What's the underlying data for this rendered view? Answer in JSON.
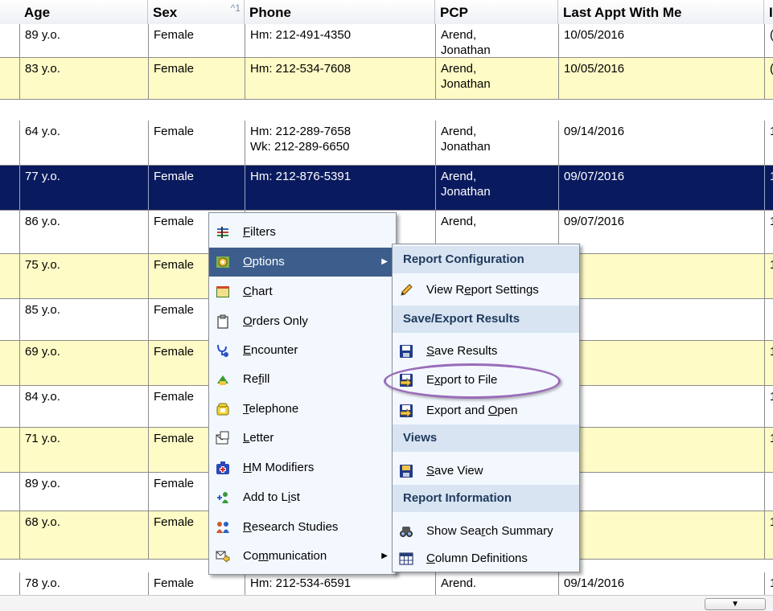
{
  "headers": {
    "age": "Age",
    "sex": "Sex",
    "sex_sort": "^1",
    "phone": "Phone",
    "pcp": "PCP",
    "last_appt": "Last Appt With Me",
    "extra": "I"
  },
  "rows": [
    {
      "age": "89 y.o.",
      "sex": "Female",
      "phone1": "Hm: 212-491-4350",
      "phone2": "",
      "pcp1": "Arend,",
      "pcp2": "Jonathan",
      "last": "10/05/2016",
      "extra": "("
    },
    {
      "age": "83 y.o.",
      "sex": "Female",
      "phone1": "Hm: 212-534-7608",
      "phone2": "",
      "pcp1": "Arend,",
      "pcp2": "Jonathan",
      "last": "10/05/2016",
      "extra": "("
    },
    {
      "age": "64 y.o.",
      "sex": "Female",
      "phone1": "Hm: 212-289-7658",
      "phone2": "Wk: 212-289-6650",
      "pcp1": "Arend,",
      "pcp2": "Jonathan",
      "last": "09/14/2016",
      "extra": "1"
    },
    {
      "age": "77 y.o.",
      "sex": "Female",
      "phone1": "Hm: 212-876-5391",
      "phone2": "",
      "pcp1": "Arend,",
      "pcp2": "Jonathan",
      "last": "09/07/2016",
      "extra": "1"
    },
    {
      "age": "86 y.o.",
      "sex": "Female",
      "phone1": "",
      "phone2": "",
      "pcp1": "Arend,",
      "pcp2": "",
      "last": "09/07/2016",
      "extra": "1"
    },
    {
      "age": "75 y.o.",
      "sex": "Female",
      "phone1": "",
      "phone2": "",
      "pcp1": "",
      "pcp2": "",
      "last": "",
      "extra": "1"
    },
    {
      "age": "85 y.o.",
      "sex": "Female",
      "phone1": "",
      "phone2": "",
      "pcp1": "",
      "pcp2": "",
      "last": "",
      "extra": ""
    },
    {
      "age": "69 y.o.",
      "sex": "Female",
      "phone1": "",
      "phone2": "",
      "pcp1": "",
      "pcp2": "",
      "last": "",
      "extra": "1"
    },
    {
      "age": "84 y.o.",
      "sex": "Female",
      "phone1": "",
      "phone2": "",
      "pcp1": "",
      "pcp2": "",
      "last": "",
      "extra": "1"
    },
    {
      "age": "71 y.o.",
      "sex": "Female",
      "phone1": "",
      "phone2": "",
      "pcp1": "",
      "pcp2": "",
      "last": "",
      "extra": "1"
    },
    {
      "age": "89 y.o.",
      "sex": "Female",
      "phone1": "",
      "phone2": "",
      "pcp1": "",
      "pcp2": "",
      "last": "",
      "extra": ""
    },
    {
      "age": "68 y.o.",
      "sex": "Female",
      "phone1": "",
      "phone2": "",
      "pcp1": "",
      "pcp2": "",
      "last": "",
      "extra": "1"
    },
    {
      "age": "78 y.o.",
      "sex": "Female",
      "phone1": "Hm: 212-534-6591",
      "phone2": "",
      "pcp1": "Arend.",
      "pcp2": "",
      "last": "09/14/2016",
      "extra": "1"
    }
  ],
  "menu1": [
    {
      "icon": "filters-icon",
      "pre": "",
      "u": "F",
      "post": "ilters"
    },
    {
      "icon": "options-icon",
      "pre": "",
      "u": "O",
      "post": "ptions"
    },
    {
      "icon": "chart-icon",
      "pre": "",
      "u": "C",
      "post": "hart"
    },
    {
      "icon": "orders-icon",
      "pre": "",
      "u": "O",
      "post": "rders Only"
    },
    {
      "icon": "stethoscope-icon",
      "pre": "",
      "u": "E",
      "post": "ncounter"
    },
    {
      "icon": "refill-icon",
      "pre": "Re",
      "u": "f",
      "post": "ill"
    },
    {
      "icon": "telephone-icon",
      "pre": "",
      "u": "T",
      "post": "elephone"
    },
    {
      "icon": "letter-icon",
      "pre": "",
      "u": "L",
      "post": "etter"
    },
    {
      "icon": "hm-modifiers-icon",
      "pre": "",
      "u": "H",
      "post": "M Modifiers"
    },
    {
      "icon": "add-to-list-icon",
      "pre": "Add to L",
      "u": "i",
      "post": "st"
    },
    {
      "icon": "research-icon",
      "pre": "",
      "u": "R",
      "post": "esearch Studies"
    },
    {
      "icon": "communication-icon",
      "pre": "Co",
      "u": "m",
      "post": "munication"
    }
  ],
  "menu2": {
    "sec_report_config": "Report Configuration",
    "view_report_settings": {
      "pre": "View R",
      "u": "e",
      "post": "port Settings"
    },
    "sec_save_export": "Save/Export Results",
    "save_results": {
      "pre": "",
      "u": "S",
      "post": "ave Results"
    },
    "export_to_file": {
      "pre": "E",
      "u": "x",
      "post": "port to File"
    },
    "export_and_open": {
      "pre": "Export and ",
      "u": "O",
      "post": "pen"
    },
    "sec_views": "Views",
    "save_view": {
      "pre": "",
      "u": "S",
      "post": "ave View"
    },
    "sec_report_info": "Report Information",
    "show_search_summary": {
      "pre": "Show Sea",
      "u": "r",
      "post": "ch Summary"
    },
    "column_definitions": {
      "pre": "",
      "u": "C",
      "post": "olumn Definitions"
    }
  },
  "scroll_button": "▼",
  "colors": {
    "row_yellow": "#fffbc6",
    "row_selected": "#0a1a5e",
    "menu_highlight": "#3d5e8d",
    "section_header": "#d8e4f2",
    "annotation_ellipse": "#9a6bb8"
  }
}
